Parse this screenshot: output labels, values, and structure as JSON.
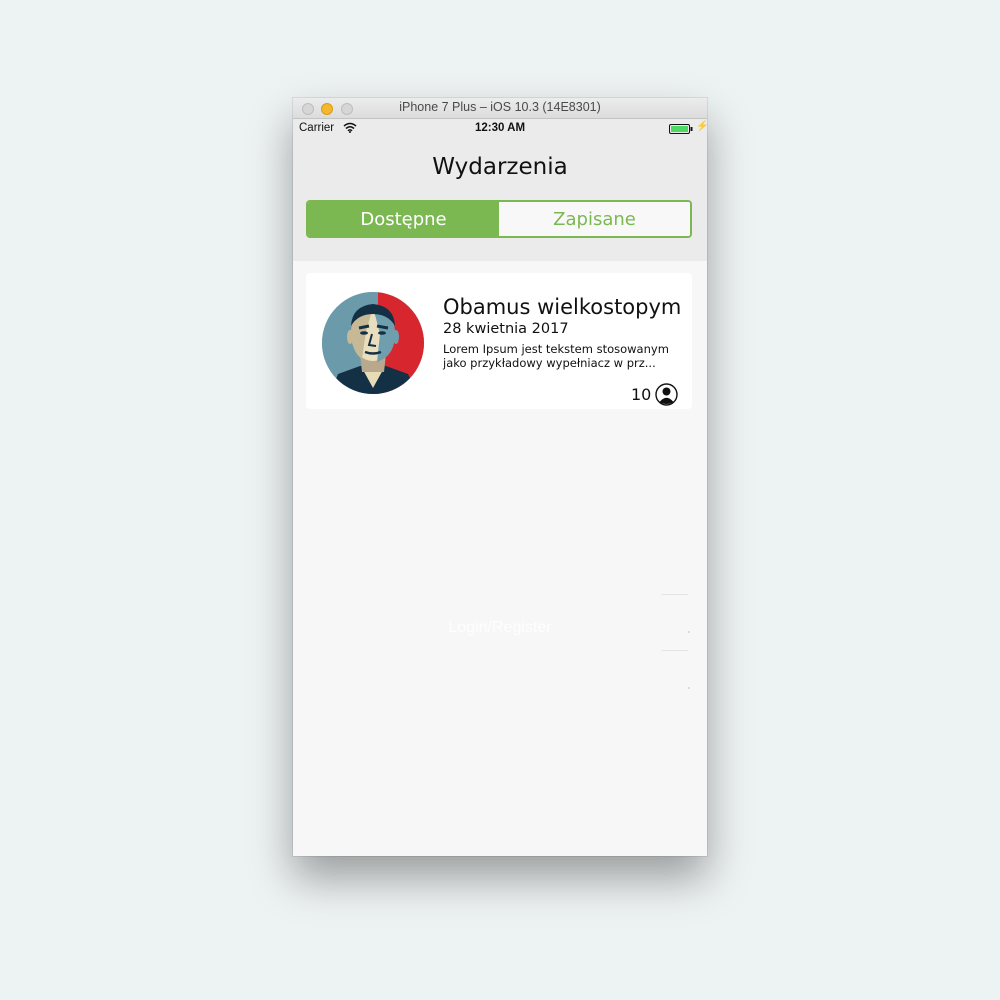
{
  "window": {
    "title": "iPhone 7 Plus – iOS 10.3 (14E8301)"
  },
  "status_bar": {
    "carrier": "Carrier",
    "time": "12:30 AM"
  },
  "header": {
    "title": "Wydarzenia"
  },
  "segments": [
    {
      "label": "Dostępne",
      "selected": true
    },
    {
      "label": "Zapisane",
      "selected": false
    }
  ],
  "colors": {
    "accent": "#7cb852",
    "header_bg": "#ebebeb",
    "content_bg": "#f7f7f7"
  },
  "events": [
    {
      "title": "Obamus wielkostopym",
      "date": "28 kwietnia 2017",
      "description_line1": "Lorem Ipsum jest tekstem stosowanym",
      "description_line2": "jako przykładowy wypełniacz w prz...",
      "attendees": "10",
      "avatar": "portrait-poster-image"
    }
  ],
  "ghost": {
    "login_label": "Login/Register"
  },
  "icons": {
    "wifi": "wifi-icon",
    "battery": "battery-icon",
    "charging": "bolt-icon",
    "person": "person-icon"
  }
}
